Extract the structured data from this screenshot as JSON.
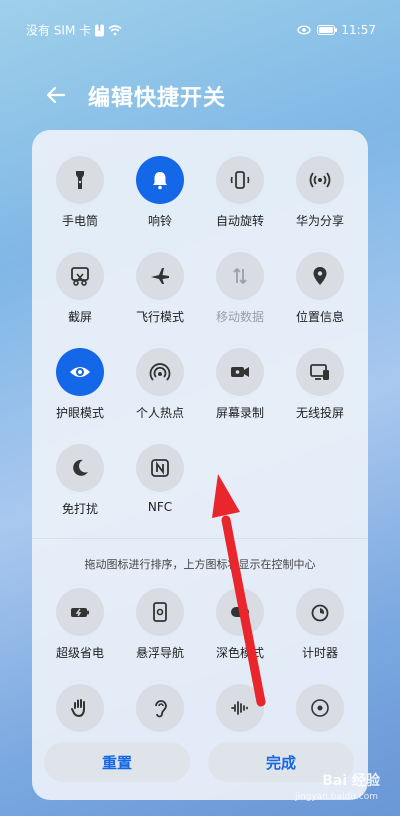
{
  "status": {
    "sim_text": "没有 SIM 卡",
    "time": "11:57"
  },
  "header": {
    "title": "编辑快捷开关"
  },
  "tiles": [
    {
      "label": "手电筒",
      "icon": "flashlight-icon",
      "active": false
    },
    {
      "label": "响铃",
      "icon": "bell-icon",
      "active": true
    },
    {
      "label": "自动旋转",
      "icon": "rotate-icon",
      "active": false
    },
    {
      "label": "华为分享",
      "icon": "share-icon",
      "active": false
    },
    {
      "label": "截屏",
      "icon": "screenshot-icon",
      "active": false
    },
    {
      "label": "飞行模式",
      "icon": "airplane-icon",
      "active": false
    },
    {
      "label": "移动数据",
      "icon": "mobile-data-icon",
      "active": false,
      "dim": true
    },
    {
      "label": "位置信息",
      "icon": "location-icon",
      "active": false
    },
    {
      "label": "护眼模式",
      "icon": "eye-icon",
      "active": true
    },
    {
      "label": "个人热点",
      "icon": "hotspot-icon",
      "active": false
    },
    {
      "label": "屏幕录制",
      "icon": "screen-record-icon",
      "active": false
    },
    {
      "label": "无线投屏",
      "icon": "wireless-projection-icon",
      "active": false
    },
    {
      "label": "免打扰",
      "icon": "moon-icon",
      "active": false
    },
    {
      "label": "NFC",
      "icon": "nfc-icon",
      "active": false
    }
  ],
  "hint": "拖动图标进行排序，上方图标将显示在控制中心",
  "more_tiles": [
    {
      "label": "超级省电",
      "icon": "power-saving-icon"
    },
    {
      "label": "悬浮导航",
      "icon": "floating-nav-icon"
    },
    {
      "label": "深色模式",
      "icon": "dark-mode-icon"
    },
    {
      "label": "计时器",
      "icon": "timer-icon"
    },
    {
      "label": "",
      "icon": "hand-icon"
    },
    {
      "label": "",
      "icon": "hearing-icon"
    },
    {
      "label": "",
      "icon": "sound-wave-icon"
    },
    {
      "label": "",
      "icon": "navigation-dot-icon"
    }
  ],
  "buttons": {
    "reset": "重置",
    "done": "完成"
  },
  "watermark": {
    "text": "Bai 经验",
    "sub": "jingyan.baidu.com"
  },
  "colors": {
    "accent": "#1467e6",
    "tile_bg": "#d9dde3",
    "arrow": "#e8262b"
  }
}
